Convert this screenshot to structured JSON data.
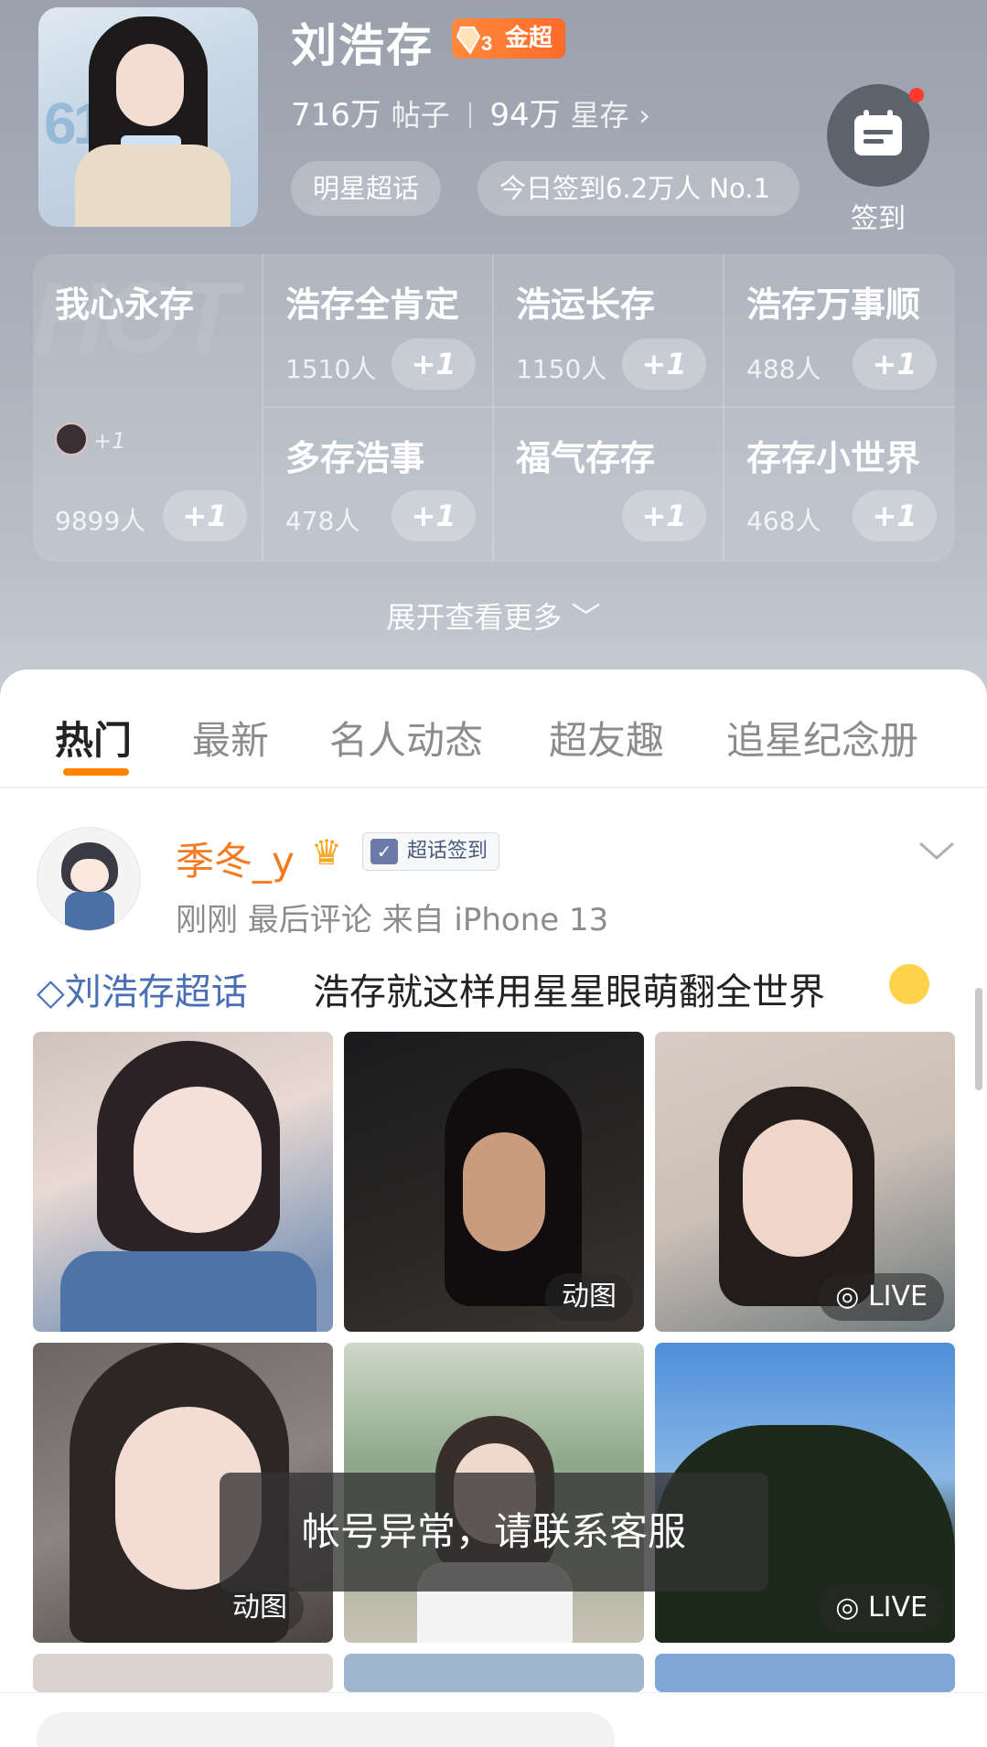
{
  "header": {
    "name": "刘浩存",
    "badge_label": "金超",
    "badge_level": "3",
    "posts_count": "716万",
    "posts_label": "帖子",
    "stars_count": "94万",
    "stars_label": "星存",
    "chip_star": "明星超话",
    "chip_checkin": "今日签到6.2万人 No.1",
    "checkin_label": "签到"
  },
  "grid": {
    "bg_text": "HOT",
    "main": {
      "name": "我心永存",
      "count": "9899人",
      "plus": "+1",
      "mini_plus": "+1"
    },
    "cells": [
      {
        "name": "浩存全肯定",
        "count": "1510人",
        "plus": "+1"
      },
      {
        "name": "浩运长存",
        "count": "1150人",
        "plus": "+1"
      },
      {
        "name": "浩存万事顺",
        "count": "488人",
        "plus": "+1"
      },
      {
        "name": "多存浩事",
        "count": "478人",
        "plus": "+1"
      },
      {
        "name": "福气存存",
        "count": "",
        "plus": "+1"
      },
      {
        "name": "存存小世界",
        "count": "468人",
        "plus": "+1"
      }
    ]
  },
  "expand_label": "展开查看更多 ﹀",
  "tabs": [
    {
      "label": "热门",
      "active": true
    },
    {
      "label": "最新"
    },
    {
      "label": "名人动态"
    },
    {
      "label": "超友趣"
    },
    {
      "label": "追星纪念册"
    }
  ],
  "post": {
    "username": "季冬_y",
    "badge": "超话签到",
    "meta": "刚刚  最后评论    来自 iPhone 13",
    "topic": "刘浩存超话",
    "text": "浩存就这样用星星眼萌翻全世界",
    "photo_labels": {
      "p2": "动图",
      "p3": "LIVE",
      "p4": "动图",
      "p6": "LIVE"
    }
  },
  "toast": "帐号异常，请联系客服",
  "colors": {
    "accent_orange": "#ff8200",
    "username_orange": "#f47a1f",
    "topic_blue": "#4a6fb5"
  }
}
